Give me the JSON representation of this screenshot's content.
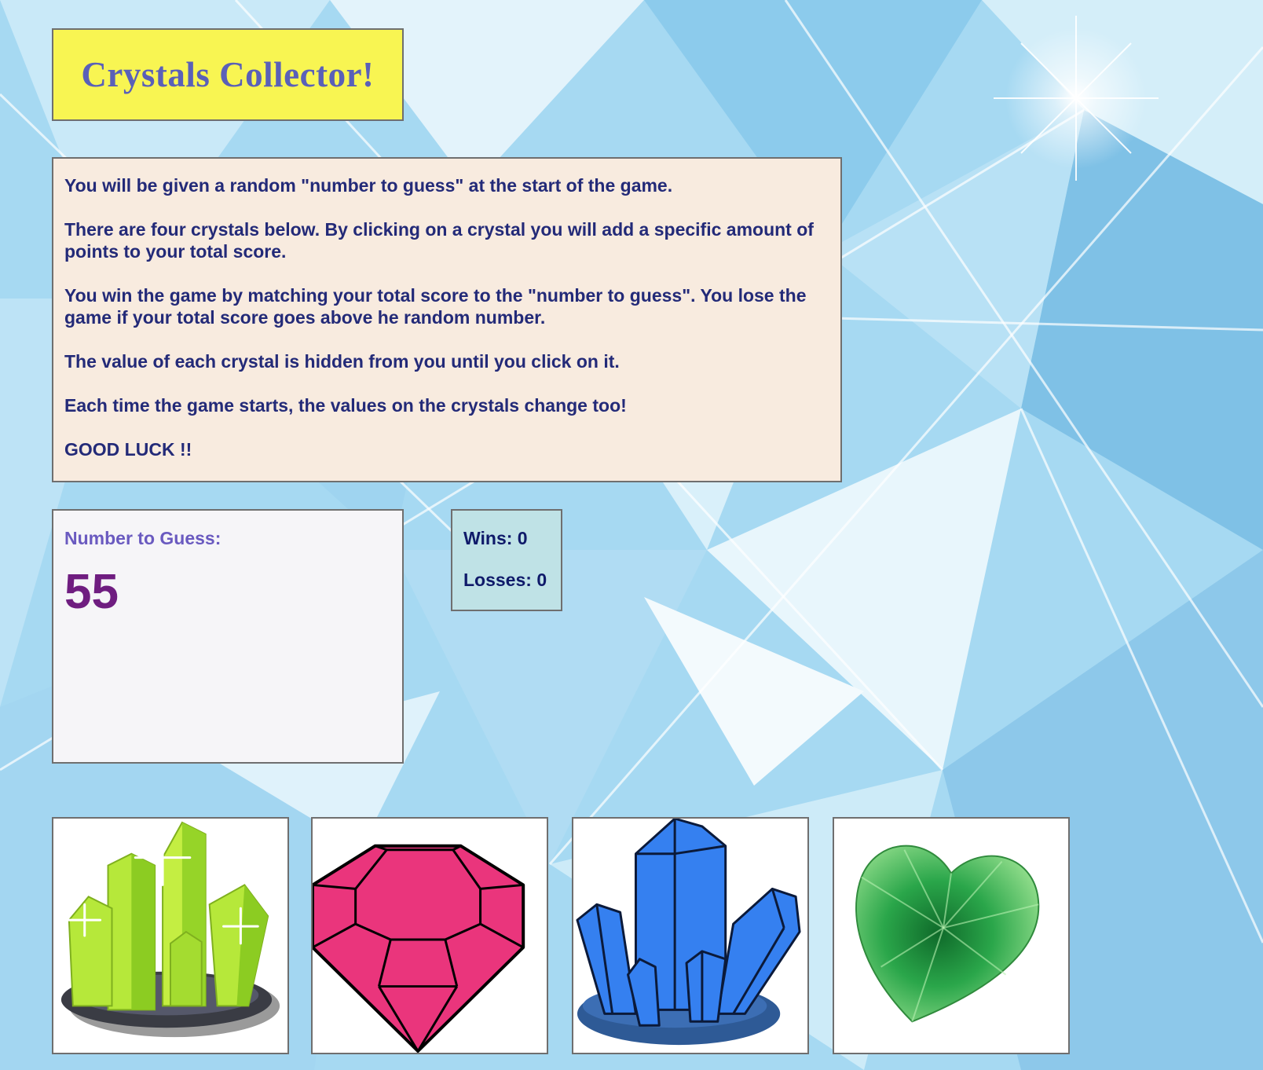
{
  "title": "Crystals Collector!",
  "instructions": [
    "You will be given a random \"number to guess\" at the start of the game.",
    "There are four crystals below. By clicking on a crystal you will add a specific amount of points to your total score.",
    "You win the game by matching your total score to the \"number to guess\". You lose the game if your total score goes above he random number.",
    "The value of each crystal is hidden from you until you click on it.",
    "Each time the game starts, the values on the crystals change too!",
    "GOOD LUCK !!"
  ],
  "guess": {
    "label": "Number to Guess:",
    "value": "55"
  },
  "stats": {
    "wins": "Wins: 0",
    "losses": "Losses: 0"
  },
  "crystals": [
    {
      "icon": "green-crystal-cluster-icon",
      "color": "#a8e23c"
    },
    {
      "icon": "pink-gem-icon",
      "color": "#ea357c"
    },
    {
      "icon": "blue-crystal-cluster-icon",
      "color": "#3580f0"
    },
    {
      "icon": "green-heart-gem-icon",
      "color": "#2aa64a"
    }
  ],
  "colors": {
    "title_bg": "#f8f552",
    "title_text": "#5a60b8",
    "instructions_bg": "#f8ebdf",
    "instructions_text": "#232a78",
    "guess_number": "#6f1d80",
    "stats_bg": "#bfe2e6"
  }
}
